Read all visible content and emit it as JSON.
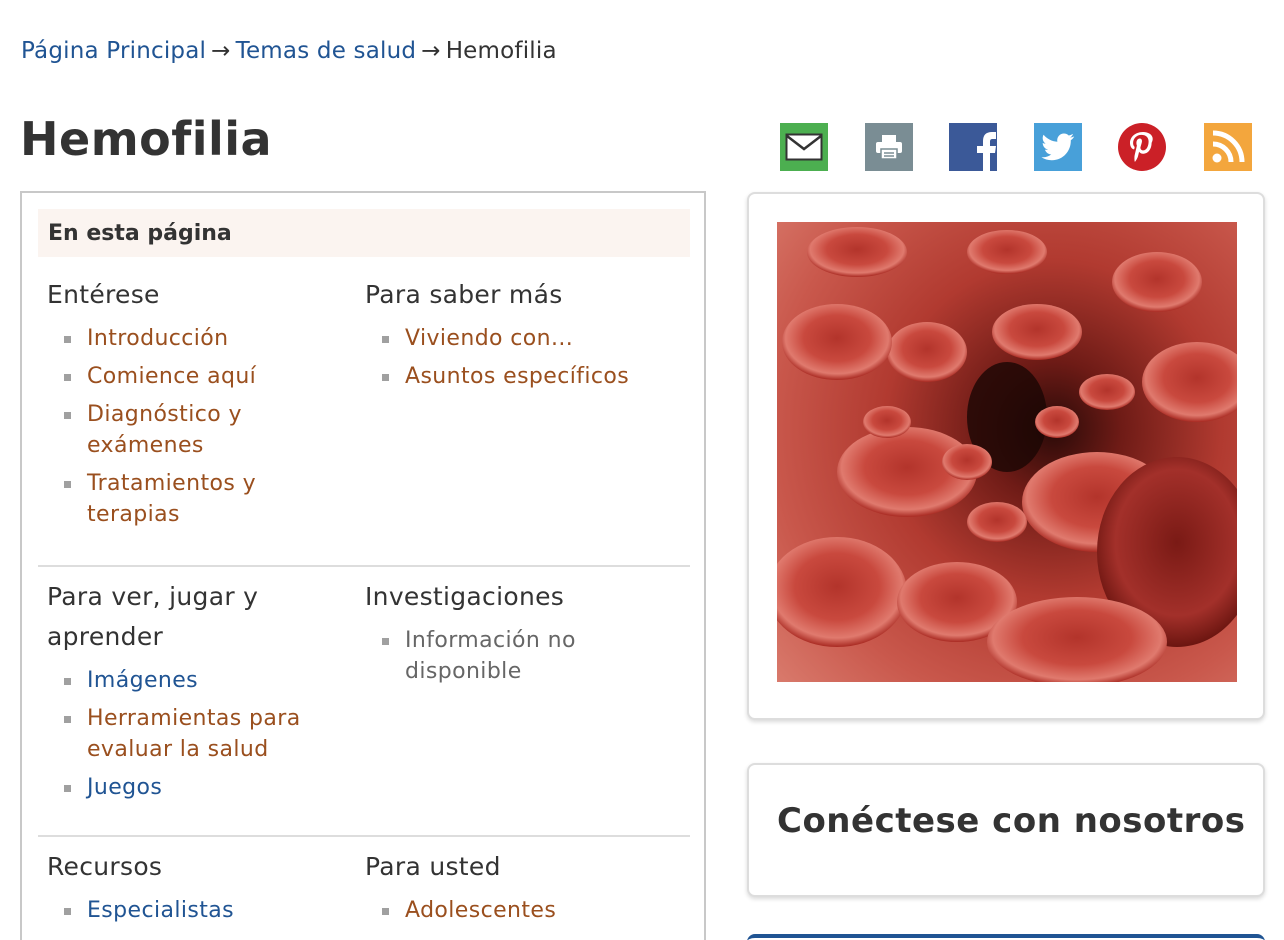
{
  "breadcrumb": {
    "items": [
      "Página Principal",
      "Temas de salud"
    ],
    "separator": "→",
    "current": "Hemofilia"
  },
  "page_title": "Hemofilia",
  "share_icons": [
    "email-icon",
    "print-icon",
    "facebook-icon",
    "twitter-icon",
    "pinterest-icon",
    "rss-icon"
  ],
  "toc": {
    "header": "En esta página",
    "sections": [
      {
        "left": {
          "title": "Entérese",
          "items": [
            "Introducción",
            "Comience aquí",
            "Diagnóstico y exámenes",
            "Tratamientos y terapias"
          ]
        },
        "right": {
          "title": "Para saber más",
          "items": [
            "Viviendo con...",
            "Asuntos específicos"
          ]
        }
      },
      {
        "left": {
          "title": "Para ver, jugar y aprender",
          "items": [
            "Imágenes",
            "Herramientas para evaluar la salud",
            "Juegos"
          ]
        },
        "right": {
          "title": "Investigaciones",
          "items": [
            "Información no disponible"
          ]
        }
      },
      {
        "left": {
          "title": "Recursos",
          "items": [
            "Especialistas"
          ]
        },
        "right": {
          "title": "Para usted",
          "items": [
            "Adolescentes"
          ]
        }
      }
    ]
  },
  "connect": {
    "title": "Conéctese con nosotros"
  },
  "colors": {
    "link_brown": "#9a4f1e",
    "link_blue": "#205493",
    "email_green": "#4caf50",
    "facebook_blue": "#3b5998",
    "twitter_blue": "#48a0d9",
    "pinterest_red": "#cb2027",
    "rss_orange": "#f3a63d",
    "toc_header_bg": "#fbf4f0"
  }
}
